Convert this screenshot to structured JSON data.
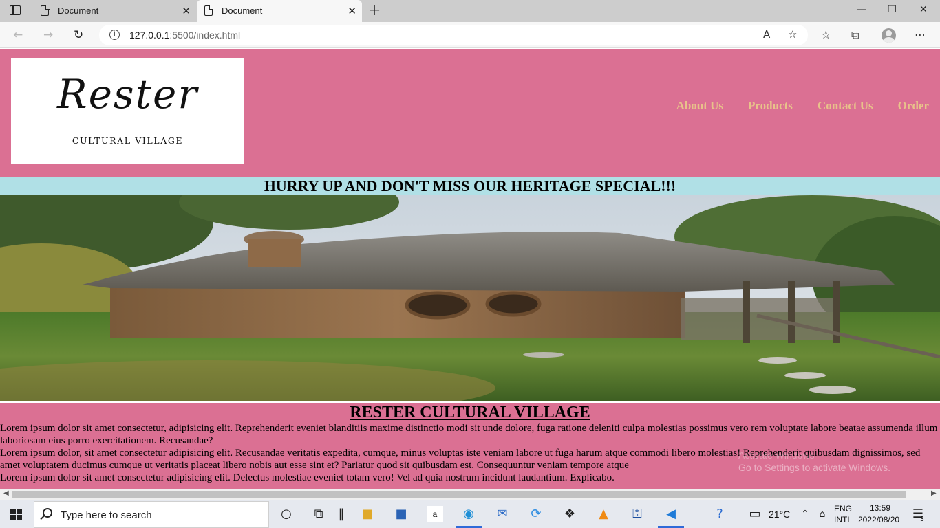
{
  "browser": {
    "tabs": [
      {
        "title": "Document",
        "active": false
      },
      {
        "title": "Document",
        "active": true
      }
    ],
    "url_host": "127.0.0.1",
    "url_path": ":5500/index.html"
  },
  "site": {
    "logo": {
      "script": "Rester",
      "subtitle": "CULTURAL VILLAGE"
    },
    "nav": [
      "About Us",
      "Products",
      "Contact Us",
      "Order"
    ],
    "promo": "HURRY UP AND DON'T MISS OUR HERITAGE SPECIAL!!!",
    "about": {
      "heading": "RESTER CULTURAL VILLAGE",
      "paragraphs": [
        "Lorem ipsum dolor sit amet consectetur, adipisicing elit. Reprehenderit eveniet blanditiis maxime distinctio modi sit unde dolore, fuga ratione deleniti culpa molestias possimus vero rem voluptate labore beatae assumenda illum laboriosam eius porro exercitationem. Recusandae?",
        "Lorem ipsum dolor, sit amet consectetur adipisicing elit. Recusandae veritatis expedita, cumque, minus voluptas iste veniam labore ut fuga harum atque commodi libero molestias! Reprehenderit quibusdam dignissimos, sed amet voluptatem ducimus cumque ut veritatis placeat libero nobis aut esse sint et? Pariatur quod sit quibusdam est. Consequuntur veniam tempore atque",
        "Lorem ipsum dolor sit amet consectetur adipisicing elit. Delectus molestiae eveniet totam vero! Vel ad quia nostrum incidunt laudantium. Explicabo."
      ]
    },
    "watermark": {
      "line1": "Activate Windows",
      "line2": "Go to Settings to activate Windows."
    },
    "colors": {
      "header": "#db7093",
      "promo": "#b0e0e6",
      "nav_text": "#e8c28a"
    }
  },
  "taskbar": {
    "search_placeholder": "Type here to search",
    "weather": "21°C",
    "lang1": "ENG",
    "lang2": "INTL",
    "time": "13:59",
    "date": "2022/08/20",
    "notifications": "3"
  }
}
